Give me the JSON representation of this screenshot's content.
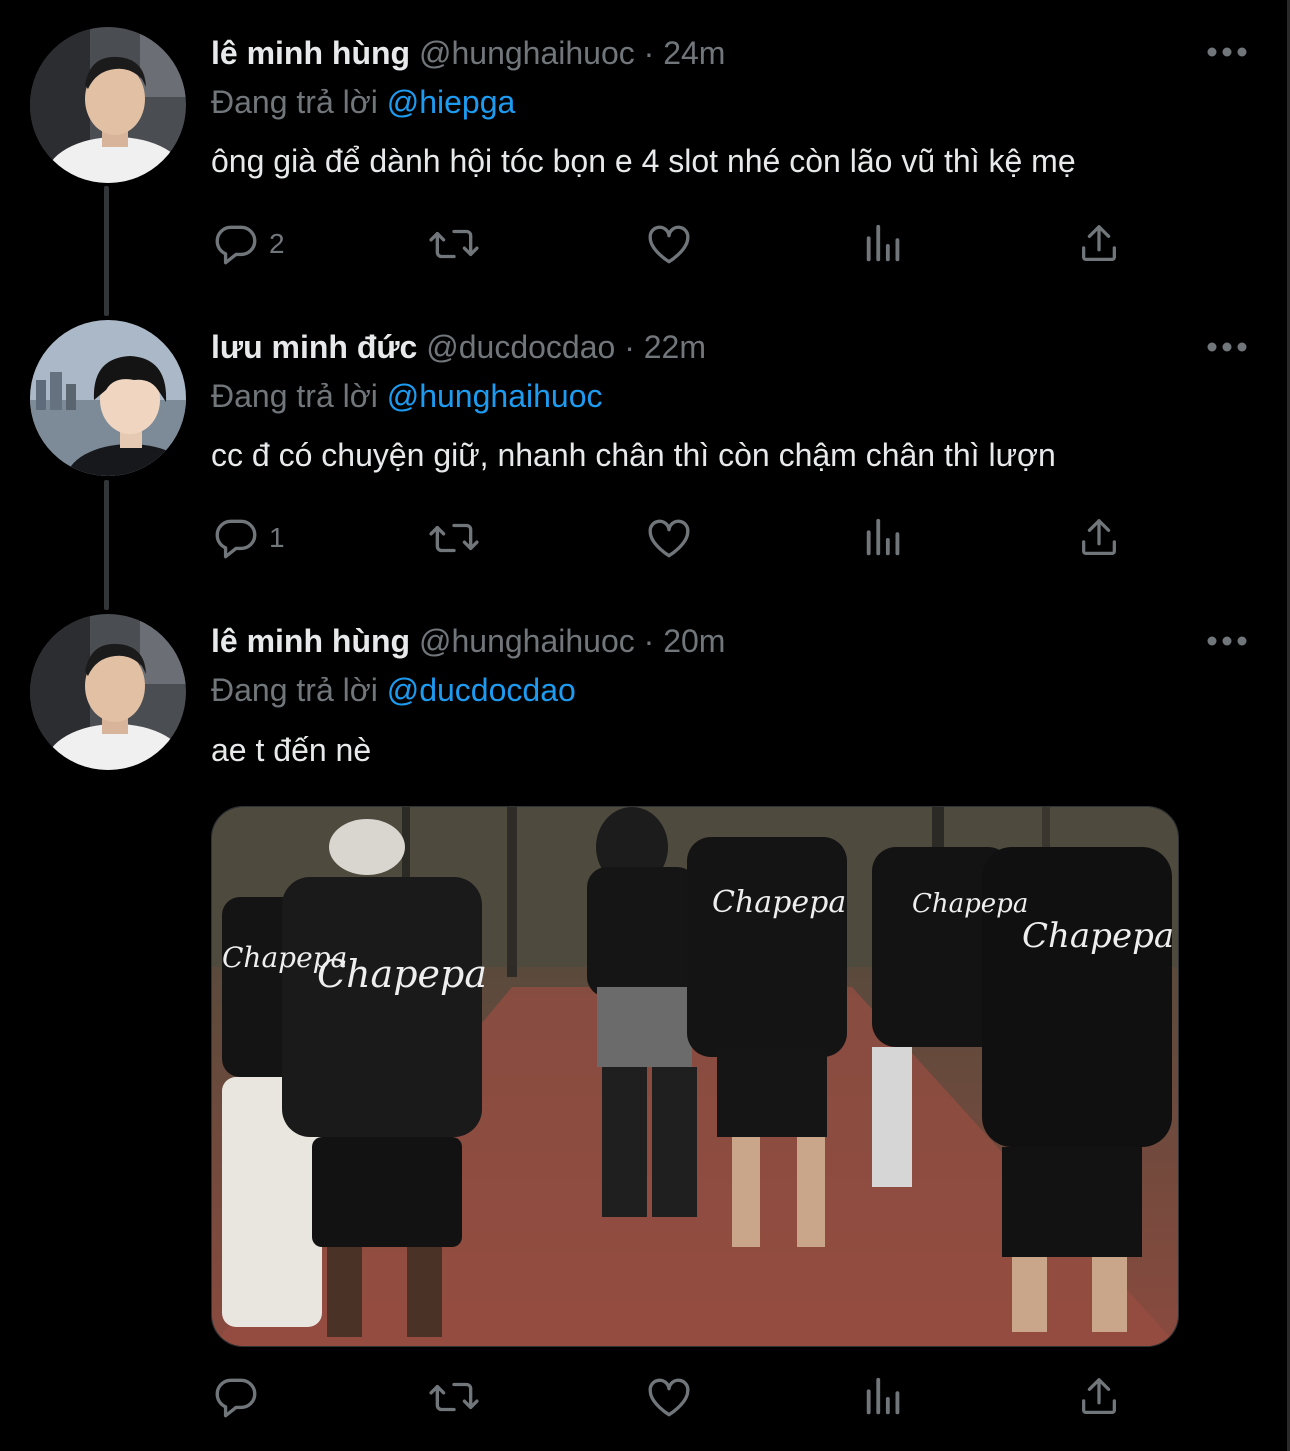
{
  "tweets": [
    {
      "name": "lê minh hùng",
      "handle": "@hunghaihuoc",
      "dot": "·",
      "time": "24m",
      "reply_prefix": "Đang trả lời ",
      "reply_to": "@hiepga",
      "text": "ông già để dành hội tóc bọn e 4 slot nhé còn lão vũ thì kệ mẹ",
      "reply_count": "2"
    },
    {
      "name": "lưu minh đức",
      "handle": "@ducdocdao",
      "dot": "·",
      "time": "22m",
      "reply_prefix": "Đang trả lời ",
      "reply_to": "@hunghaihuoc",
      "text": "cc đ có chuyện giữ, nhanh chân thì còn chậm chân thì lượn",
      "reply_count": "1"
    },
    {
      "name": "lê minh hùng",
      "handle": "@hunghaihuoc",
      "dot": "·",
      "time": "20m",
      "reply_prefix": "Đang trả lời ",
      "reply_to": "@ducdocdao",
      "text": "ae t đến nè",
      "reply_count": ""
    }
  ],
  "media": {
    "shirt_text": "Chapepa"
  },
  "icons": {
    "more": "more-horizontal-icon",
    "reply": "reply-bubble-icon",
    "retweet": "retweet-icon",
    "like": "heart-icon",
    "views": "views-bar-chart-icon",
    "share": "share-icon"
  },
  "colors": {
    "background": "#000000",
    "text_primary": "#e7e9ea",
    "text_secondary": "#71767b",
    "accent": "#1d9bf0",
    "thread_line": "#333639"
  }
}
